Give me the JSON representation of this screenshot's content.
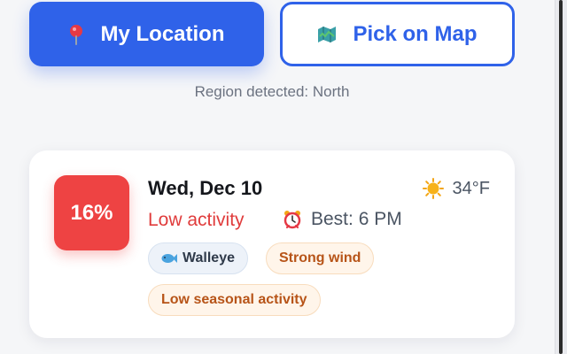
{
  "location": {
    "my_location_label": "My Location",
    "pick_on_map_label": "Pick on Map",
    "region_text": "Region detected: North",
    "icons": {
      "my_location": "pin-icon",
      "pick_on_map": "map-icon"
    }
  },
  "forecast": {
    "score": "16%",
    "date": "Wed, Dec 10",
    "temperature": "34°F",
    "weather_icon": "sun-icon",
    "activity": "Low activity",
    "best_time": "Best: 6 PM",
    "best_icon": "alarm-clock-icon",
    "species_chip": "Walleye",
    "species_icon": "fish-icon",
    "warning_chips": [
      "Strong wind",
      "Low seasonal activity"
    ]
  },
  "colors": {
    "primary": "#2f62e9",
    "danger": "#ee4343",
    "warning_text": "#b75418"
  }
}
